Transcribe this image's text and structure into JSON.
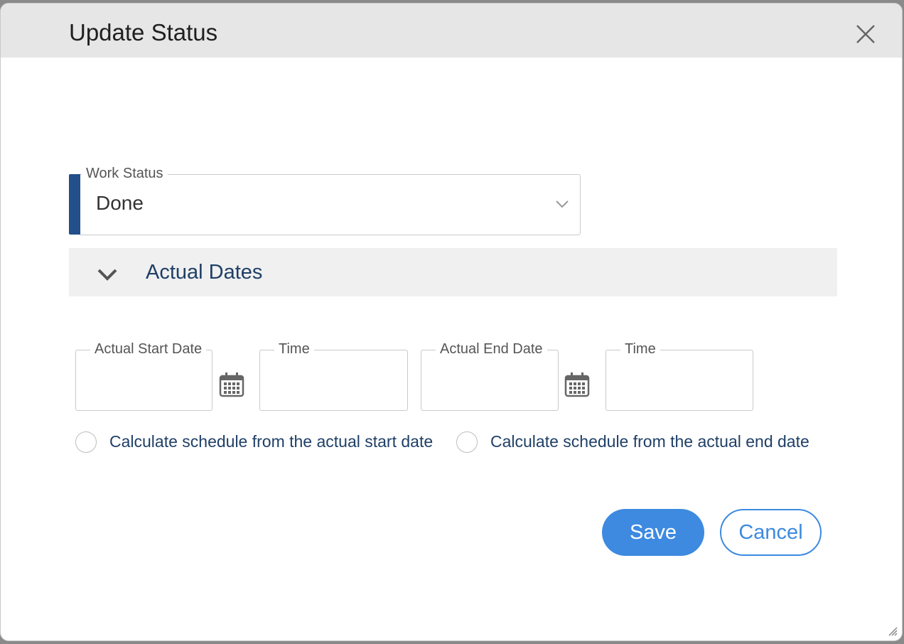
{
  "dialog": {
    "title": "Update Status"
  },
  "work_status": {
    "label": "Work Status",
    "value": "Done"
  },
  "actual_dates": {
    "title": "Actual Dates",
    "start_date_label": "Actual Start Date",
    "start_time_label": "Time",
    "end_date_label": "Actual End Date",
    "end_time_label": "Time",
    "start_date_value": "",
    "start_time_value": "",
    "end_date_value": "",
    "end_time_value": "",
    "radio_start_label": "Calculate schedule from the actual start date",
    "radio_end_label": "Calculate schedule from the actual end date"
  },
  "buttons": {
    "save": "Save",
    "cancel": "Cancel"
  },
  "colors": {
    "accent": "#3d8ae0",
    "status_bar": "#21508a",
    "section_text": "#1f3f66"
  },
  "icons": {
    "close": "close-icon",
    "chevron_status": "chevron-down-icon",
    "section_toggle": "chevron-down-icon",
    "calendar": "calendar-icon"
  }
}
